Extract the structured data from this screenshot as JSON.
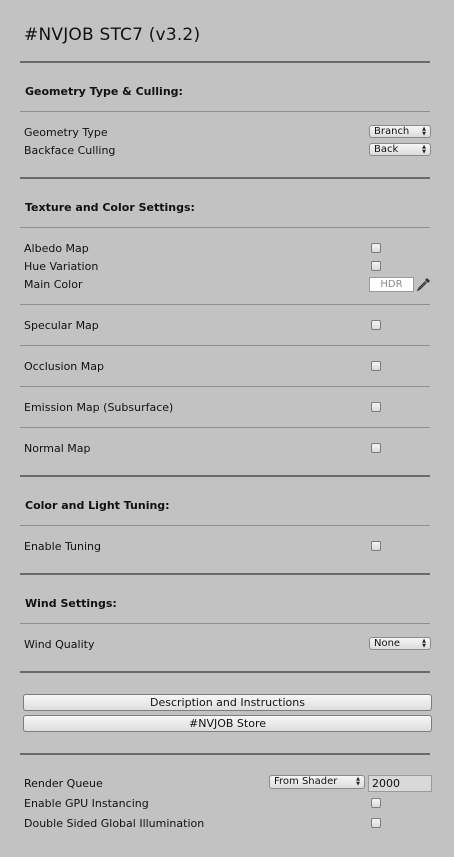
{
  "title": "#NVJOB STC7 (v3.2)",
  "sections": {
    "geometry": {
      "heading": "Geometry Type & Culling:",
      "geometry_type_label": "Geometry Type",
      "geometry_type_value": "Branch",
      "backface_label": "Backface Culling",
      "backface_value": "Back"
    },
    "texture": {
      "heading": "Texture and Color Settings:",
      "albedo_label": "Albedo Map",
      "hue_label": "Hue Variation",
      "main_color_label": "Main Color",
      "main_color_placeholder": "HDR",
      "specular_label": "Specular Map",
      "occlusion_label": "Occlusion Map",
      "emission_label": "Emission Map (Subsurface)",
      "normal_label": "Normal Map"
    },
    "tuning": {
      "heading": "Color and Light Tuning:",
      "enable_label": "Enable Tuning"
    },
    "wind": {
      "heading": "Wind Settings:",
      "quality_label": "Wind Quality",
      "quality_value": "None"
    },
    "buttons": {
      "description": "Description and Instructions",
      "store": "#NVJOB Store"
    },
    "render": {
      "queue_label": "Render Queue",
      "queue_mode": "From Shader",
      "queue_value": "2000",
      "gpu_label": "Enable GPU Instancing",
      "dsgi_label": "Double Sided Global Illumination"
    }
  },
  "icons": {
    "dropdown_arrow": "updown-arrow-icon",
    "color_picker": "eyedropper-icon"
  }
}
